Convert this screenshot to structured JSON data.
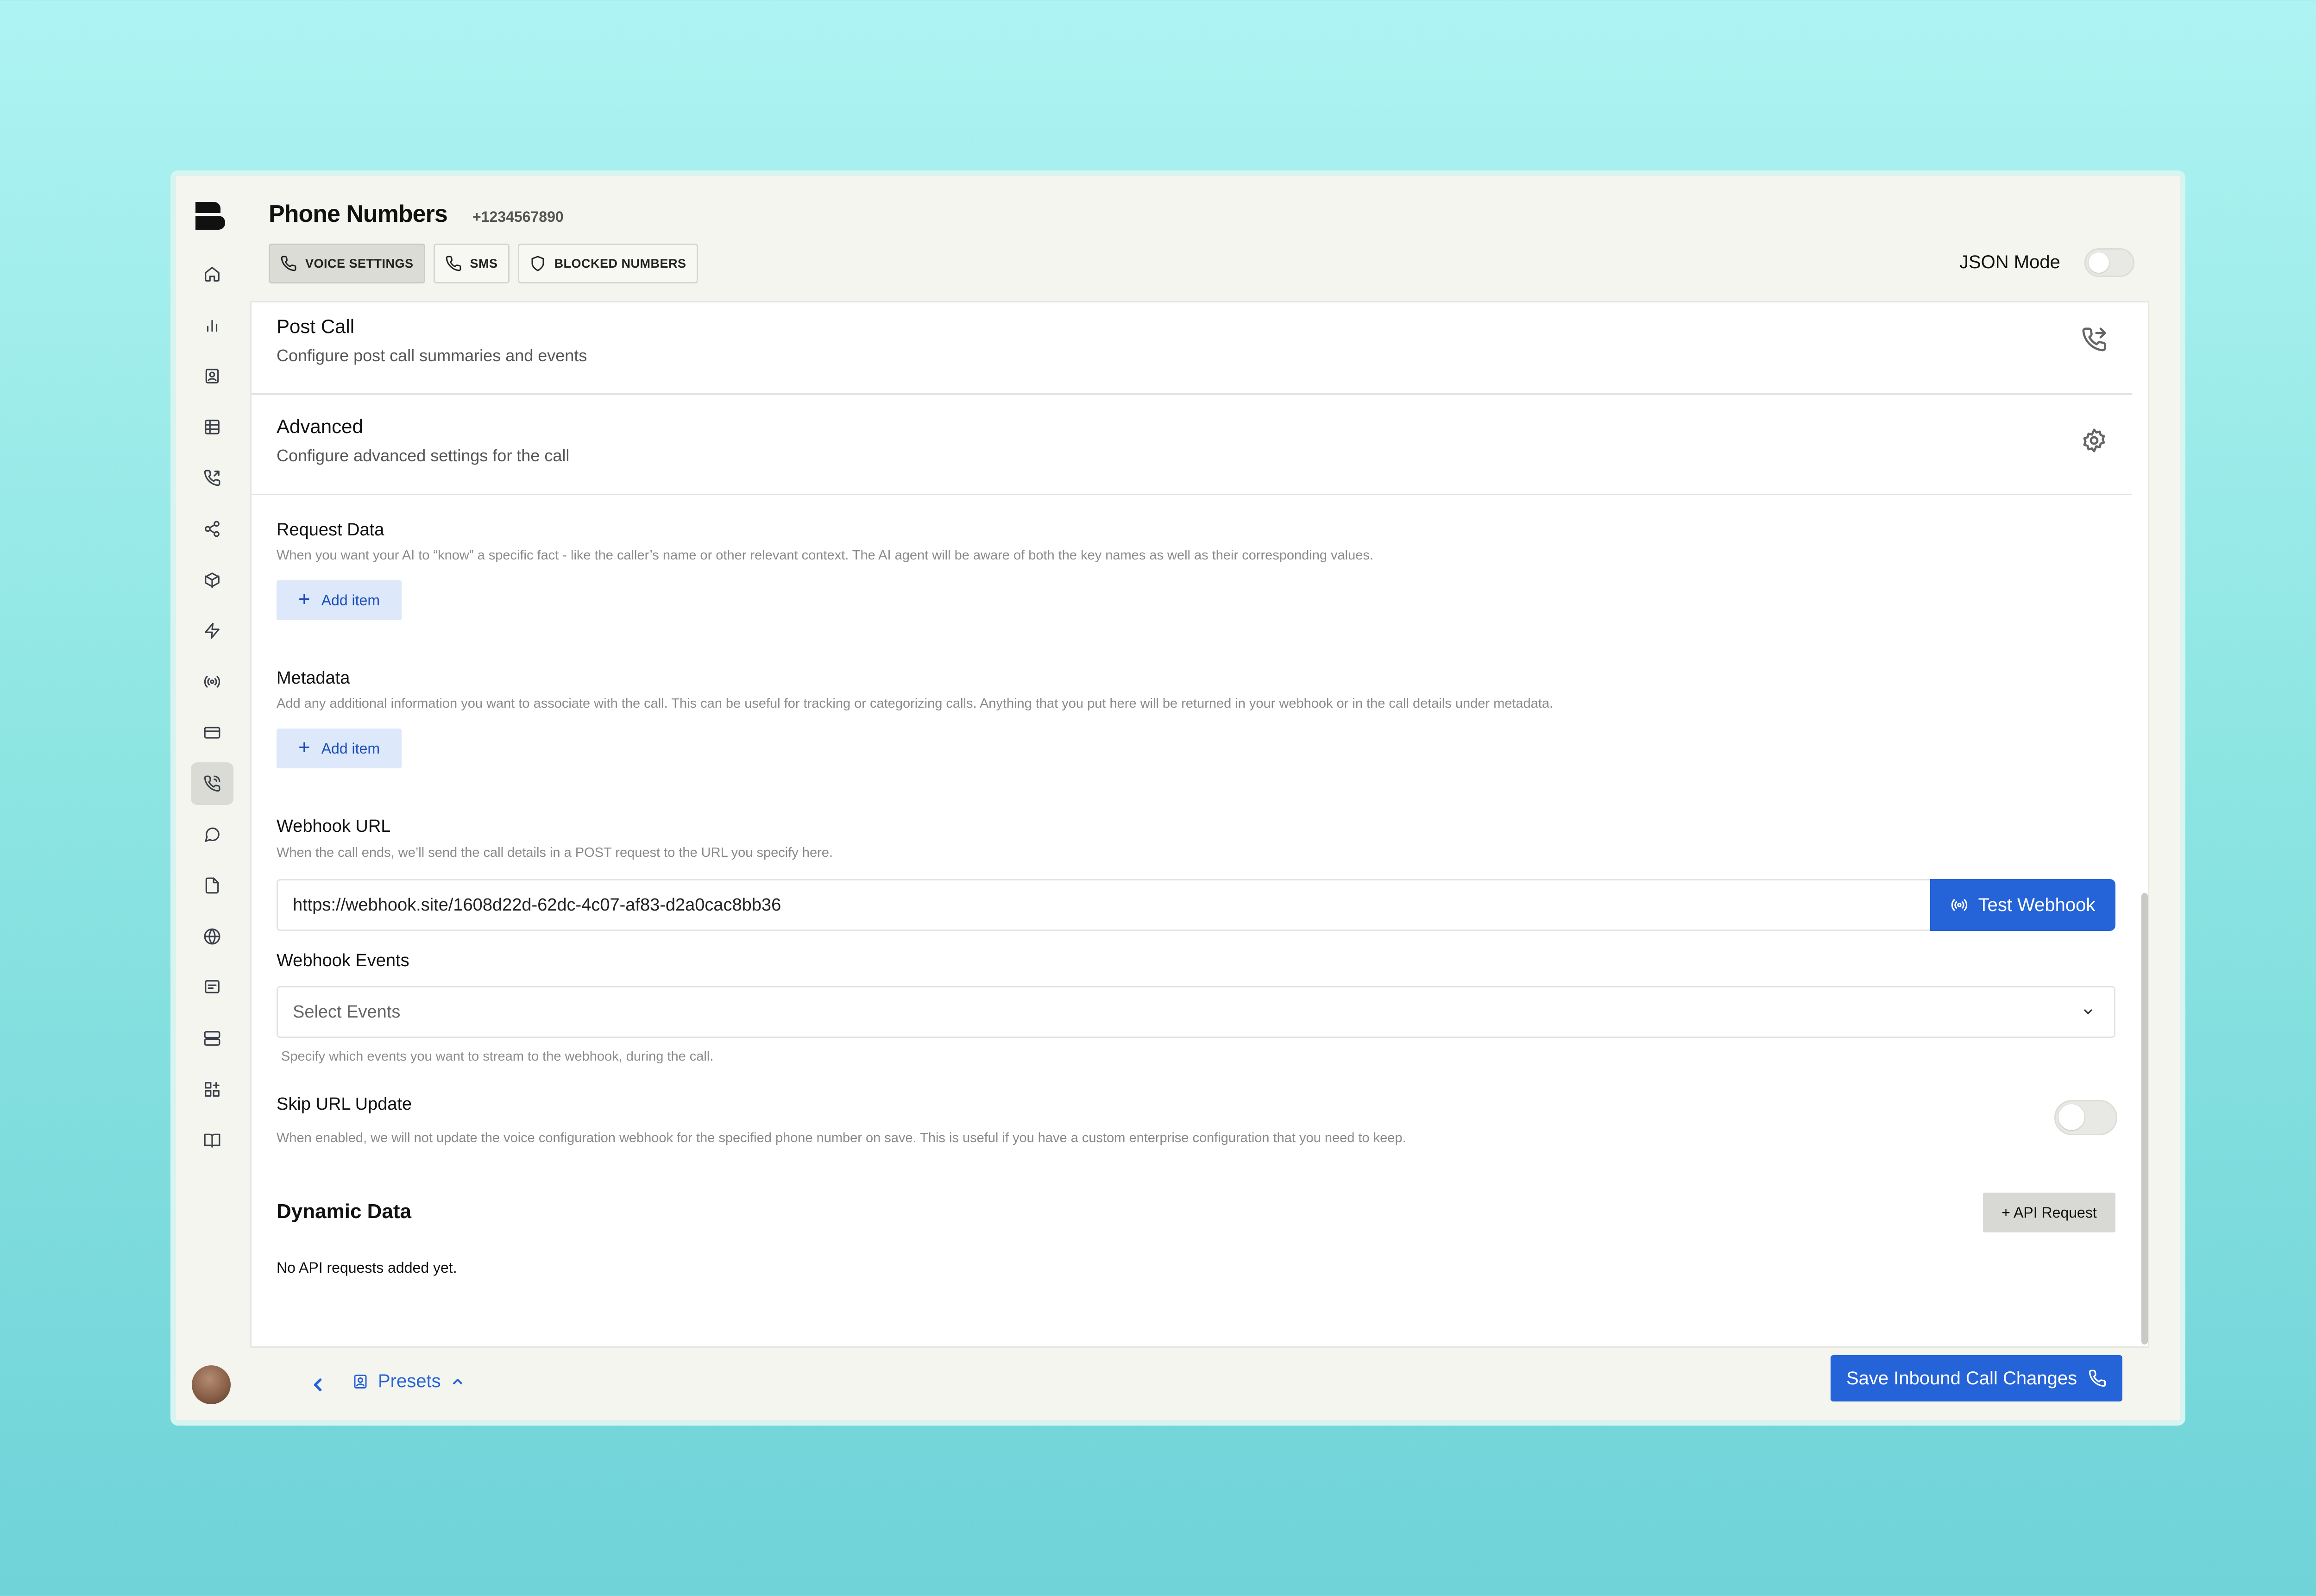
{
  "header": {
    "title": "Phone Numbers",
    "phone_number": "+1234567890"
  },
  "tabs": [
    {
      "label": "VOICE SETTINGS",
      "icon": "phone-icon",
      "active": true
    },
    {
      "label": "SMS",
      "icon": "phone-icon",
      "active": false
    },
    {
      "label": "BLOCKED NUMBERS",
      "icon": "shield-icon",
      "active": false
    }
  ],
  "json_mode": {
    "label": "JSON Mode",
    "enabled": false
  },
  "sidebar": {
    "items": [
      "home-icon",
      "chart-icon",
      "contact-icon",
      "table-icon",
      "phone-outgoing-icon",
      "share-icon",
      "box-icon",
      "lightning-icon",
      "radio-icon",
      "card-icon",
      "phone-call-icon",
      "message-circle-icon",
      "file-icon",
      "globe-icon",
      "message-square-icon",
      "server-icon",
      "widgets-icon",
      "book-icon"
    ],
    "active_index": 10
  },
  "sections": {
    "post_call": {
      "title": "Post Call",
      "description": "Configure post call summaries and events"
    },
    "advanced": {
      "title": "Advanced",
      "description": "Configure advanced settings for the call"
    }
  },
  "request_data": {
    "label": "Request Data",
    "hint": "When you want your AI to “know” a specific fact - like the caller’s name or other relevant context. The AI agent will be aware of both the key names as well as their corresponding values.",
    "button": "Add item"
  },
  "metadata": {
    "label": "Metadata",
    "hint": "Add any additional information you want to associate with the call. This can be useful for tracking or categorizing calls. Anything that you put here will be returned in your webhook or in the call details under metadata.",
    "button": "Add item"
  },
  "webhook_url": {
    "label": "Webhook URL",
    "hint": "When the call ends, we’ll send the call details in a POST request to the URL you specify here.",
    "value": "https://webhook.site/1608d22d-62dc-4c07-af83-d2a0cac8bb36",
    "test_button": "Test Webhook"
  },
  "webhook_events": {
    "label": "Webhook Events",
    "placeholder": "Select Events",
    "hint": "Specify which events you want to stream to the webhook, during the call."
  },
  "skip_url_update": {
    "label": "Skip URL Update",
    "hint": "When enabled, we will not update the voice configuration webhook for the specified phone number on save. This is useful if you have a custom enterprise configuration that you need to keep.",
    "enabled": false
  },
  "dynamic_data": {
    "label": "Dynamic Data",
    "button": "+ API Request",
    "empty": "No API requests added yet."
  },
  "footer": {
    "presets": "Presets",
    "save_button": "Save Inbound Call Changes"
  },
  "colors": {
    "accent": "#2563d8",
    "accent_light": "#dde8fb"
  }
}
